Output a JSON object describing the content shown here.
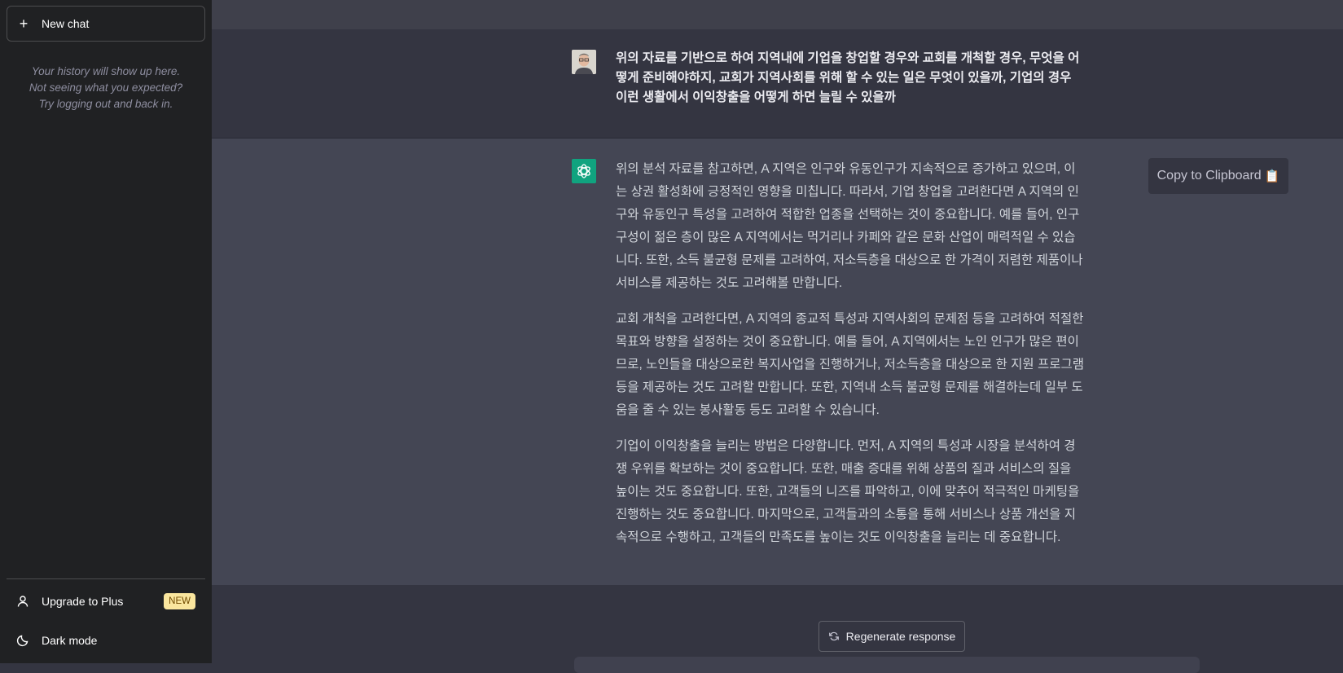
{
  "sidebar": {
    "new_chat_label": "New chat",
    "history_note": [
      "Your history will show up here.",
      "Not seeing what you expected?",
      "Try logging out and back in."
    ],
    "upgrade_label": "Upgrade to Plus",
    "upgrade_badge": "NEW",
    "dark_mode_label": "Dark mode"
  },
  "conversation": {
    "user_message_lines": [
      "위의 자료를 기반으로 하여 지역내에 기업을 창업할 경우와 교회를 개척할 경우, 무엇을 어",
      "떻게 준비해야하지,  교회가 지역사회를 위해 할 수 있는 일은 무엇이 있을까, 기업의 경우",
      "이런 생활에서 이익창출을 어떻게 하면 늘릴 수 있을까"
    ],
    "assistant_paragraphs": [
      [
        "위의 분석 자료를 참고하면, A 지역은 인구와 유동인구가 지속적으로 증가하고 있으며, 이",
        "는 상권 활성화에 긍정적인 영향을 미칩니다. 따라서, 기업 창업을 고려한다면 A 지역의 인",
        "구와 유동인구 특성을 고려하여 적합한 업종을 선택하는 것이 중요합니다. 예를 들어, 인구",
        "구성이 젊은 층이 많은 A 지역에서는 먹거리나 카페와 같은 문화 산업이 매력적일 수 있습",
        "니다. 또한, 소득 불균형 문제를 고려하여, 저소득층을 대상으로 한 가격이 저렴한 제품이나",
        "서비스를 제공하는 것도 고려해볼 만합니다."
      ],
      [
        "교회 개척을 고려한다면, A 지역의 종교적 특성과 지역사회의 문제점 등을 고려하여 적절한",
        "목표와 방향을 설정하는 것이 중요합니다. 예를 들어, A 지역에서는 노인 인구가 많은 편이",
        "므로, 노인들을 대상으로한 복지사업을 진행하거나, 저소득층을 대상으로 한 지원 프로그램",
        "등을 제공하는 것도 고려할 만합니다. 또한, 지역내 소득 불균형 문제를 해결하는데 일부 도",
        "움을 줄 수 있는 봉사활동 등도 고려할 수 있습니다."
      ],
      [
        "기업이 이익창출을 늘리는 방법은 다양합니다. 먼저, A 지역의 특성과 시장을 분석하여 경",
        "쟁 우위를 확보하는 것이 중요합니다. 또한, 매출 증대를 위해 상품의 질과 서비스의 질을",
        "높이는 것도 중요합니다. 또한, 고객들의 니즈를 파악하고, 이에 맞추어 적극적인 마케팅을",
        "진행하는 것도 중요합니다. 마지막으로, 고객들과의 소통을 통해 서비스나 상품 개선을 지",
        "속적으로 수행하고, 고객들의 만족도를 높이는 것도 이익창출을 늘리는 데 중요합니다."
      ]
    ],
    "copy_label": "Copy to Clipboard",
    "copy_icon": "📋"
  },
  "footer": {
    "regenerate_label": "Regenerate response"
  },
  "colors": {
    "sidebar_bg": "#202123",
    "main_bg": "#343541",
    "assistant_bg": "#444654",
    "brand_green": "#10a37f",
    "badge_bg": "#fae69e"
  },
  "icons": {
    "new_chat": "plus-icon",
    "upgrade": "user-icon",
    "dark_mode": "moon-icon",
    "regenerate": "refresh-icon",
    "assistant_avatar": "openai-logo-icon"
  }
}
